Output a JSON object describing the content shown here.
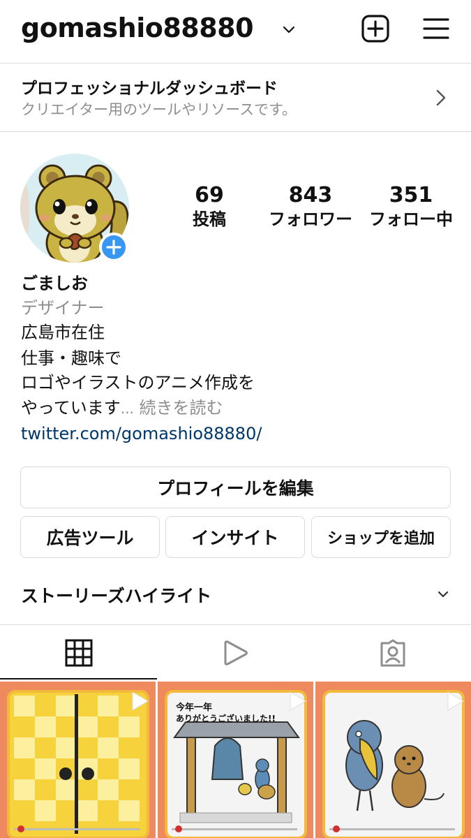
{
  "header": {
    "username": "gomashio88880"
  },
  "dashboard": {
    "title": "プロフェッショナルダッシュボード",
    "subtitle": "クリエイター用のツールやリソースです。"
  },
  "stats": [
    {
      "value": "69",
      "label": "投稿"
    },
    {
      "value": "843",
      "label": "フォロワー"
    },
    {
      "value": "351",
      "label": "フォロー中"
    }
  ],
  "bio": {
    "name": "ごましお",
    "category": "デザイナー",
    "lines": [
      "広島市在住",
      "仕事・趣味で",
      "ロゴやイラストのアニメ作成を"
    ],
    "last_line": "やっています",
    "ellipsis": "...",
    "more": "続きを読む",
    "link": "twitter.com/gomashio88880/"
  },
  "buttons": {
    "edit_profile": "プロフィールを編集",
    "ad_tools": "広告ツール",
    "insights": "インサイト",
    "add_shop": "ショップを追加"
  },
  "highlights": {
    "title": "ストーリーズハイライト"
  },
  "tabs": [
    {
      "icon": "grid-icon",
      "active": true
    },
    {
      "icon": "reels-icon",
      "active": false
    },
    {
      "icon": "tagged-icon",
      "active": false
    }
  ],
  "posts": [
    {
      "icon": "reel-play-icon"
    },
    {
      "icon": "reel-play-icon",
      "caption_line1": "今年一年",
      "caption_line2": "ありがとうございました!!"
    },
    {
      "icon": "reel-play-icon"
    }
  ],
  "colors": {
    "link": "#00376b",
    "accent": "#3897f0",
    "secondary_text": "#8e8e8e",
    "border": "#dbdbdb"
  }
}
